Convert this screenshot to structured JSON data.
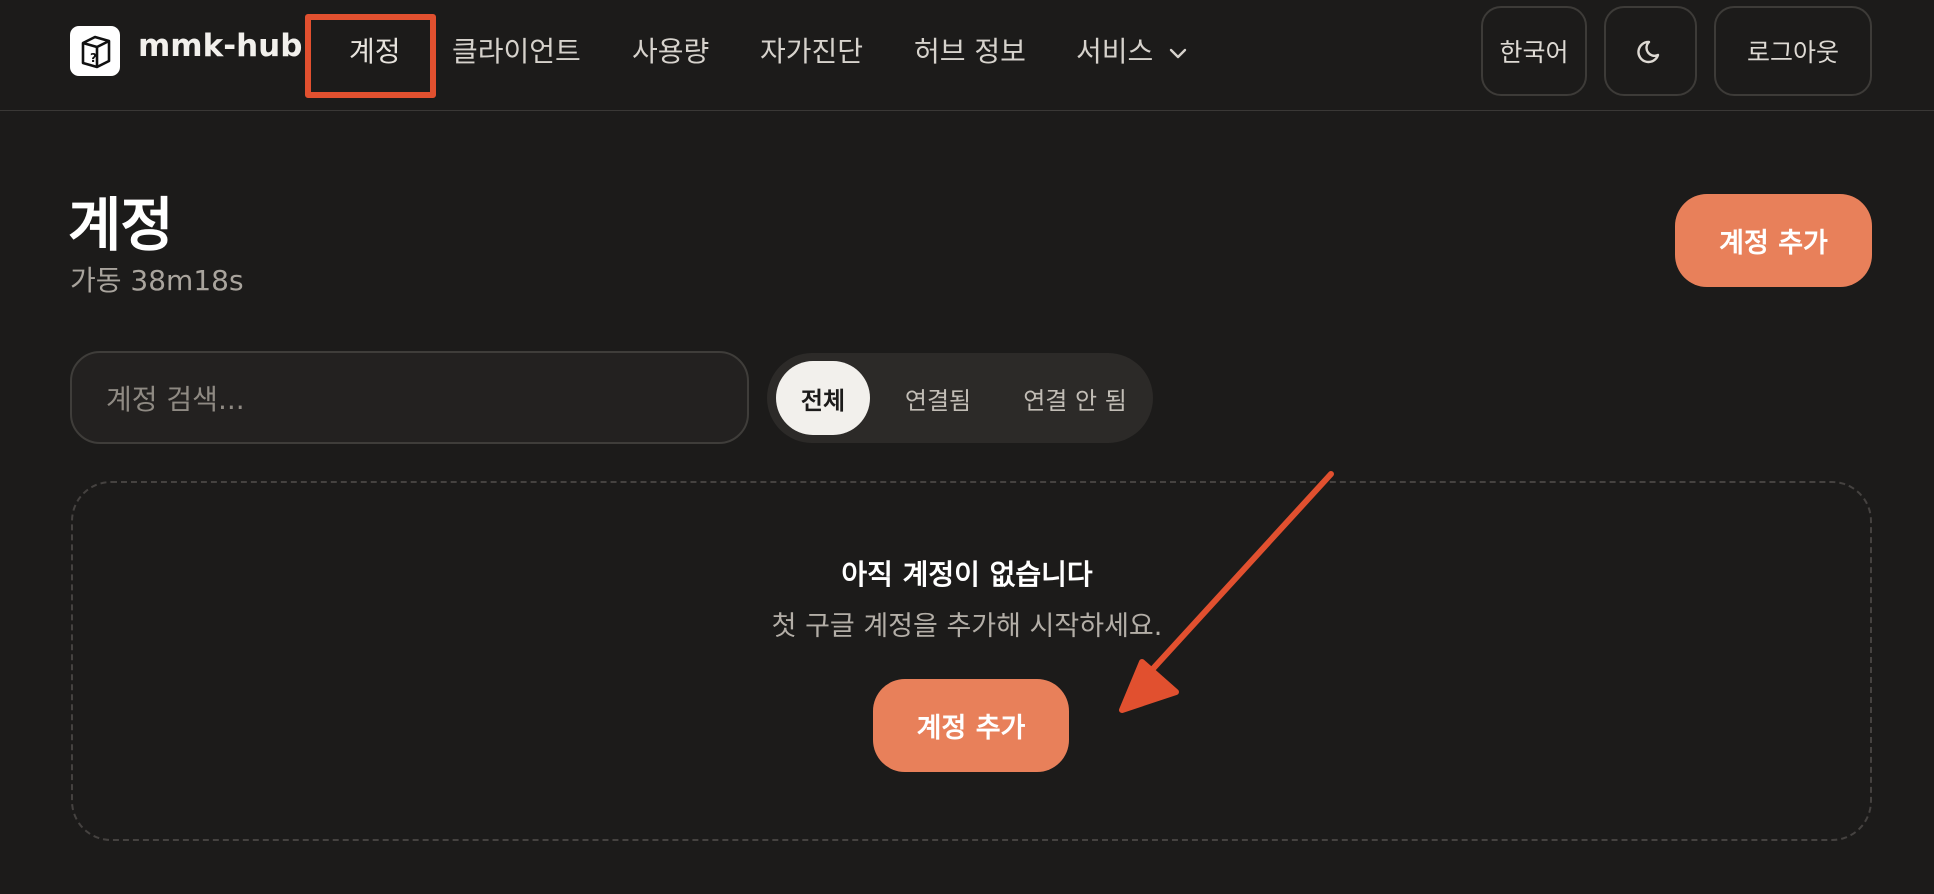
{
  "header": {
    "brand": "mmk-hub",
    "nav": [
      "계정",
      "클라이언트",
      "사용량",
      "자가진단",
      "허브 정보",
      "서비스"
    ],
    "language_button": "한국어",
    "logout_button": "로그아웃",
    "theme_icon": "moon-icon",
    "services_dropdown_icon": "chevron-down-icon",
    "logo_icon": "box-question-icon"
  },
  "page": {
    "title": "계정",
    "uptime": "가동 38m18s",
    "add_account_button": "계정 추가"
  },
  "filters": {
    "search_placeholder": "계정 검색...",
    "segments": [
      "전체",
      "연결됨",
      "연결 안 됨"
    ],
    "selected": "전체"
  },
  "empty_state": {
    "title": "아직 계정이 없습니다",
    "subtitle": "첫 구글 계정을 추가해 시작하세요.",
    "button": "계정 추가"
  },
  "colors": {
    "background": "#1c1b1a",
    "accent": "#e8805a",
    "annotation": "#e1502f"
  }
}
